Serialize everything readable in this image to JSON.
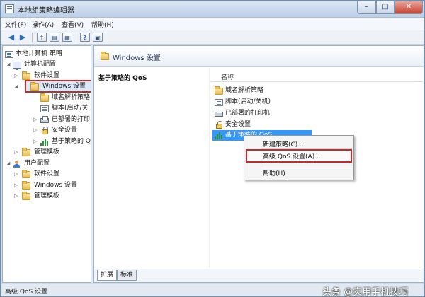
{
  "window": {
    "title": "本地组策略编辑器"
  },
  "menubar": {
    "items": [
      "文件(F)",
      "操作(A)",
      "查看(V)",
      "帮助(H)"
    ]
  },
  "tree": {
    "root": "本地计算机 策略",
    "computer_config": "计算机配置",
    "software_settings": "软件设置",
    "windows_settings": "Windows 设置",
    "dns_policy": "域名解析策略",
    "scripts": "脚本(启动/关",
    "printers": "已部署的打印",
    "security": "安全设置",
    "qos": "基于策略的 Q",
    "admin_templates": "管理模板",
    "user_config": "用户配置",
    "user_software": "软件设置",
    "user_windows": "Windows 设置",
    "user_admin": "管理模板"
  },
  "right_pane": {
    "header": "Windows 设置",
    "policy_title": "基于策略的 QoS",
    "column_name": "名称",
    "items": [
      "域名解析策略",
      "脚本(启动/关机)",
      "已部署的打印机",
      "安全设置",
      "基于策略的 QoS"
    ]
  },
  "context_menu": {
    "new_policy": "新建策略(C)...",
    "advanced_qos": "高级 QoS 设置(A)...",
    "help": "帮助(H)"
  },
  "tabs": {
    "extended": "扩展",
    "standard": "标准"
  },
  "status": {
    "text": "高级 QoS 设置"
  },
  "watermark": "头条 @实用手机技巧",
  "colors": {
    "highlight_box": "#c82a2a",
    "selection": "#3399ff"
  }
}
